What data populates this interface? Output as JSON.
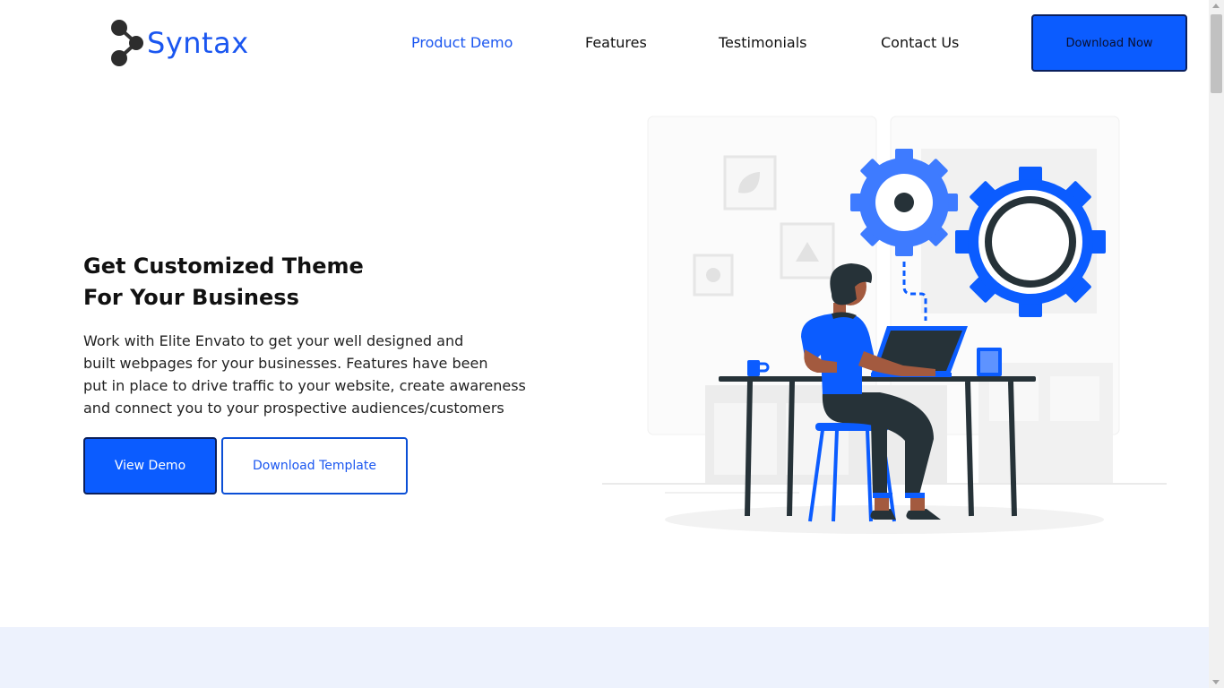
{
  "brand": {
    "name": "Syntax",
    "accent_color": "#0b5cff",
    "logo_icon": "molecule-icon"
  },
  "nav": {
    "items": [
      {
        "label": "Product Demo",
        "active": true
      },
      {
        "label": "Features",
        "active": false
      },
      {
        "label": "Testimonials",
        "active": false
      },
      {
        "label": "Contact Us",
        "active": false
      }
    ],
    "cta_label": "Download Now"
  },
  "hero": {
    "title_line1": "Get Customized Theme",
    "title_line2": "For Your Business",
    "description_lines": [
      "Work with Elite Envato to get your well designed and",
      "built webpages for your businesses. Features have been",
      "put in place to drive traffic to your website, create awareness",
      "and connect you to your prospective audiences/customers"
    ],
    "primary_button": "View Demo",
    "secondary_button": "Download Template",
    "illustration_icon": "developer-at-desk-with-gears-illustration"
  },
  "colors": {
    "band_background": "#edf2fd",
    "primary_blue": "#0b5cff",
    "dark": "#263238"
  }
}
